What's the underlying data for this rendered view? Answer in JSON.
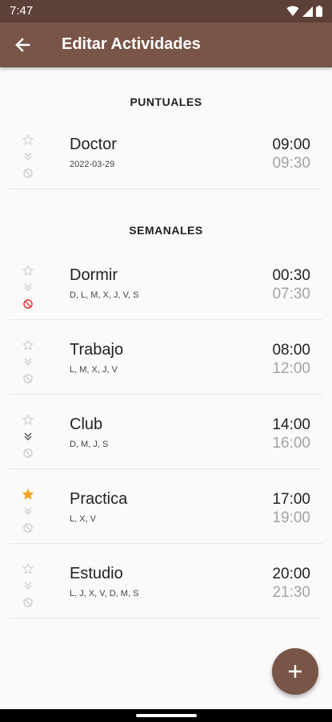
{
  "status": {
    "time": "7:47"
  },
  "app_bar": {
    "title": "Editar Actividades"
  },
  "sections": {
    "puntuales": "PUNTUALES",
    "semanales": "SEMANALES"
  },
  "puntuales": [
    {
      "name": "Doctor",
      "detail": "2022-03-29",
      "start": "09:00",
      "end": "09:30",
      "starred": false,
      "priority": false,
      "blocked": false
    }
  ],
  "semanales": [
    {
      "name": "Dormir",
      "detail": "D, L, M, X, J, V, S",
      "start": "00:30",
      "end": "07:30",
      "starred": false,
      "priority": false,
      "blocked": true
    },
    {
      "name": "Trabajo",
      "detail": "L, M, X, J, V",
      "start": "08:00",
      "end": "12:00",
      "starred": false,
      "priority": false,
      "blocked": false
    },
    {
      "name": "Club",
      "detail": "D, M, J, S",
      "start": "14:00",
      "end": "16:00",
      "starred": false,
      "priority": true,
      "blocked": false
    },
    {
      "name": "Practica",
      "detail": "L, X, V",
      "start": "17:00",
      "end": "19:00",
      "starred": true,
      "priority": false,
      "blocked": false
    },
    {
      "name": "Estudio",
      "detail": "L, J, X, V, D, M, S",
      "start": "20:00",
      "end": "21:30",
      "starred": false,
      "priority": false,
      "blocked": false
    }
  ],
  "colors": {
    "status_bar": "#5d4037",
    "app_bar": "#795548",
    "star_active": "#f5a623",
    "blocked_active": "#e53935",
    "icon_inactive": "#cfcfcf",
    "priority_active": "#555555"
  }
}
